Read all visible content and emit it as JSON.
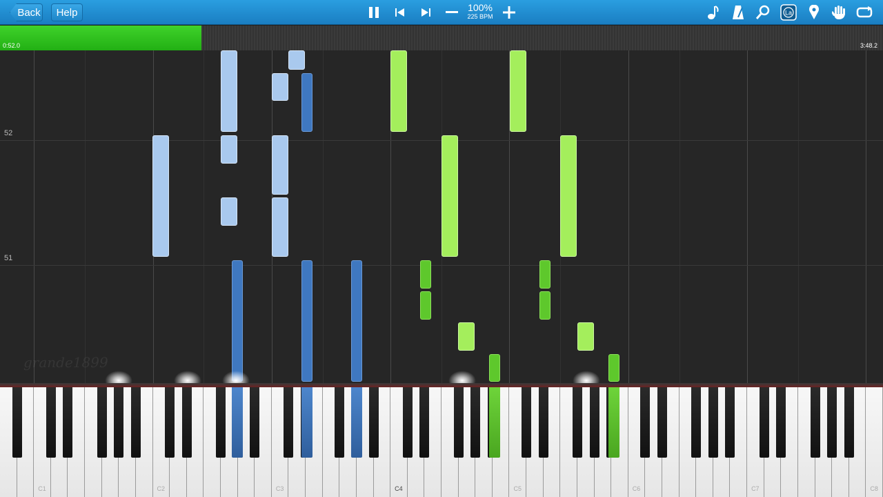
{
  "toolbar": {
    "back_label": "Back",
    "help_label": "Help",
    "zoom": "100%",
    "bpm": "225 BPM",
    "icons": [
      "pause-icon",
      "skip-back-icon",
      "skip-forward-icon",
      "minus-icon",
      "plus-icon",
      "note-icon",
      "metronome-icon",
      "magnifier-icon",
      "label-toggle-icon",
      "location-pin-icon",
      "hand-icon",
      "loop-icon"
    ],
    "label_icon_text": "La"
  },
  "progress": {
    "current_time": "0:52.0",
    "total_time": "3:48.2",
    "fraction": 0.228,
    "fill_color": "#2fc51e"
  },
  "measures": [
    "52",
    "51"
  ],
  "watermark": "grande1899",
  "keyboard": {
    "octave_labels": [
      "C1",
      "C2",
      "C3",
      "C4",
      "C5",
      "C6",
      "C7",
      "C8"
    ],
    "highlight_octave": "C4"
  },
  "colors": {
    "left_hand_light": "#a9c9ee",
    "left_hand_dark": "#3f78c0",
    "right_hand_light": "#a4ee5c",
    "right_hand_dark": "#5ec82c",
    "toolbar": "#2392d4"
  }
}
